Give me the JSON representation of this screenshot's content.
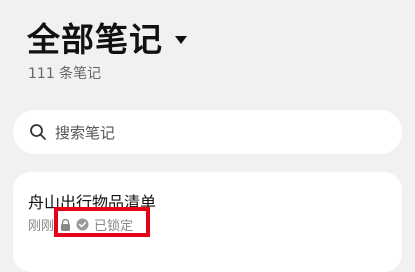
{
  "header": {
    "title": "全部笔记",
    "count": "111 条笔记"
  },
  "search": {
    "placeholder": "搜索笔记"
  },
  "note": {
    "title": "舟山出行物品清单",
    "time": "刚刚",
    "status": "已锁定"
  },
  "icons": {
    "dropdown": "caret-down-icon",
    "search": "search-icon",
    "lock": "lock-icon",
    "status": "check-circle-icon"
  },
  "colors": {
    "background": "#f1f1f3",
    "card": "#ffffff",
    "highlight": "#e8001a",
    "muted_text": "#888888"
  }
}
